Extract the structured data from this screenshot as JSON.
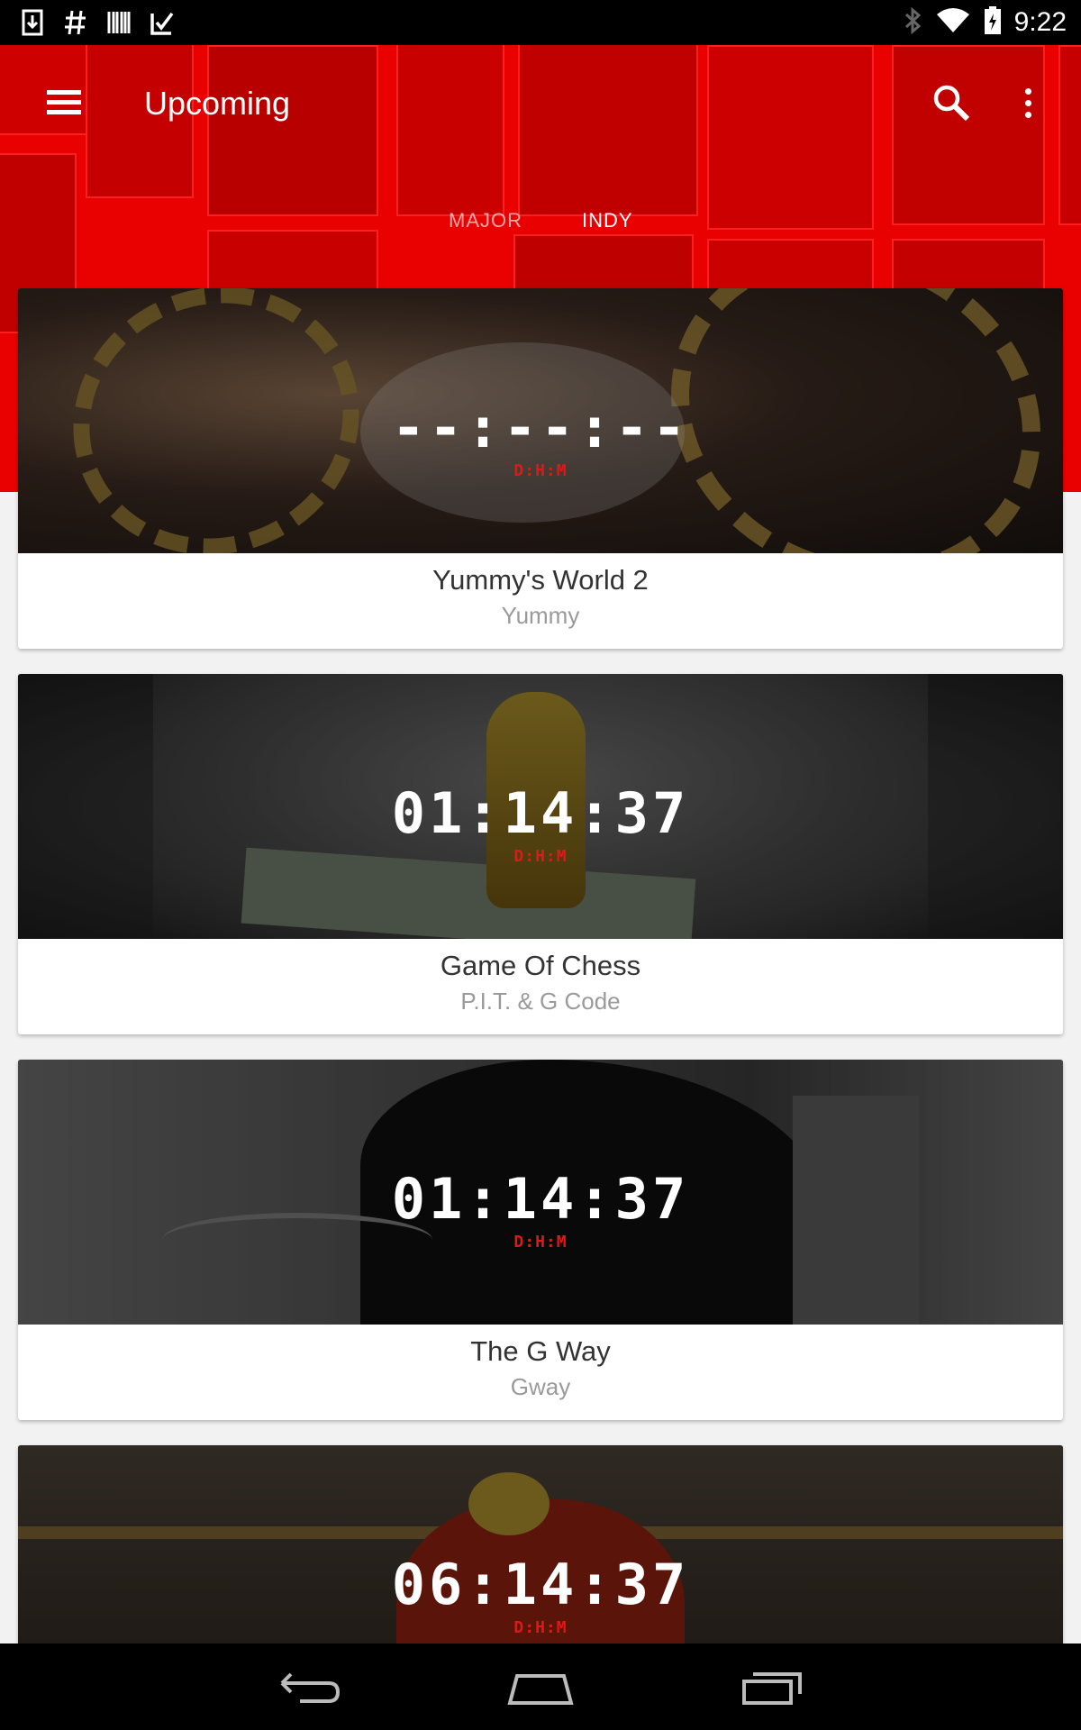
{
  "status_bar": {
    "time": "9:22",
    "left_icons": [
      "download-icon",
      "hashtag-icon",
      "barcode-icon",
      "checklist-icon"
    ],
    "right_icons": [
      "bluetooth-icon",
      "wifi-icon",
      "battery-icon"
    ]
  },
  "app_bar": {
    "title": "Upcoming",
    "icons": [
      "menu-icon",
      "search-icon",
      "more-vert-icon"
    ]
  },
  "tabs": [
    {
      "label": "MAJOR",
      "selected": false
    },
    {
      "label": "INDY",
      "selected": true
    }
  ],
  "cards": [
    {
      "countdown": "--:--:--",
      "units": "D:H:M",
      "title": "Yummy's World 2",
      "artist": "Yummy"
    },
    {
      "countdown": "01:14:37",
      "units": "D:H:M",
      "title": "Game Of Chess",
      "artist": "P.I.T. & G Code"
    },
    {
      "countdown": "01:14:37",
      "units": "D:H:M",
      "title": "The G Way",
      "artist": "Gway"
    },
    {
      "countdown": "06:14:37",
      "units": "D:H:M",
      "title": "",
      "artist": ""
    }
  ],
  "nav_bar": {
    "icons": [
      "back-icon",
      "home-icon",
      "recents-icon"
    ]
  },
  "colors": {
    "brand_red": "#e30000",
    "countdown_units": "#e01818",
    "status_bar": "#000000",
    "background": "#f2f2f2"
  }
}
